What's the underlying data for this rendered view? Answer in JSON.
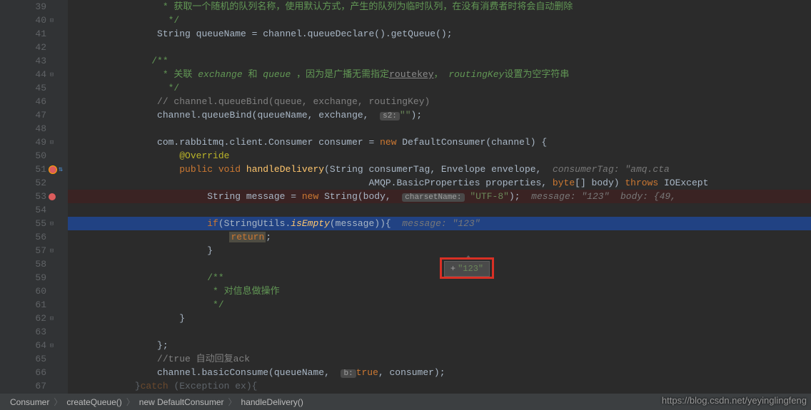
{
  "lines": {
    "start": 39,
    "end": 67,
    "current": 55,
    "breakpoint": 53
  },
  "code": {
    "l39": {
      "doc": "* 获取一个随机的队列名称，使用默认方式，产生的队列为临时队列，在没有消费者时将会自动删除"
    },
    "l40": {
      "doc": " */"
    },
    "l41": {
      "a": "String queueName = channel.queueDeclare().getQueue();"
    },
    "l43": {
      "doc": "/**"
    },
    "l44": {
      "a": "* 关联 ",
      "b": "exchange",
      "c": " 和 ",
      "d": "queue",
      "e": " ，因为是广播无需指定",
      "f": "routekey",
      "g": "， ",
      "h": "routingKey",
      "i": "设置为空字符串"
    },
    "l45": {
      "doc": " */"
    },
    "l46": {
      "cmt": "// channel.queueBind(queue, exchange, routingKey)"
    },
    "l47": {
      "a": "channel.queueBind(queueName, exchange, ",
      "p": "s2:",
      "s": "\"\"",
      "b": ");"
    },
    "l49": {
      "a": "com.rabbitmq.client.Consumer consumer = ",
      "kw": "new",
      "b": " DefaultConsumer(channel) {"
    },
    "l50": {
      "ann": "@Override"
    },
    "l51": {
      "kw1": "public",
      "sp1": " ",
      "kw2": "void",
      "sp2": " ",
      "m": "handleDelivery",
      "a": "(String consumerTag, Envelope envelope,  ",
      "h": "consumerTag: \"amq.cta"
    },
    "l52": {
      "a": "AMQP.BasicProperties properties, ",
      "kw": "byte",
      "b": "[] body) ",
      "kw2": "throws",
      "c": " IOExcept"
    },
    "l53": {
      "a": "String message = ",
      "kw": "new",
      "b": " String(body, ",
      "p": "charsetName:",
      "s": "\"UTF-8\"",
      "c": ");  ",
      "h": "message: \"123\"  body: {49, "
    },
    "l55": {
      "kw": "if",
      "a": "(StringUtils.",
      "m": "isEmpty",
      "b": "(message)){  ",
      "h": "message: \"123\""
    },
    "l56": {
      "kw": "return",
      "a": ";"
    },
    "l57": {
      "a": "}"
    },
    "l59": {
      "doc": "/**"
    },
    "l60": {
      "doc": " * 对信息做操作"
    },
    "l61": {
      "doc": " */"
    },
    "l62": {
      "a": "}"
    },
    "l64": {
      "a": "};"
    },
    "l65": {
      "cmt": "//true 自动回复ack"
    },
    "l66": {
      "a": "channel.basicConsume(queueName, ",
      "p": "b:",
      "kw": "true",
      "b": ", consumer);"
    },
    "l67": {
      "kw": "catch",
      "a": " (Exception ex){"
    }
  },
  "tooltip": {
    "plus": "+",
    "value": "\"123\""
  },
  "breadcrumb": {
    "items": [
      "Consumer",
      "createQueue()",
      "new DefaultConsumer",
      "handleDelivery()"
    ]
  },
  "watermark": "https://blog.csdn.net/yeyinglingfeng"
}
